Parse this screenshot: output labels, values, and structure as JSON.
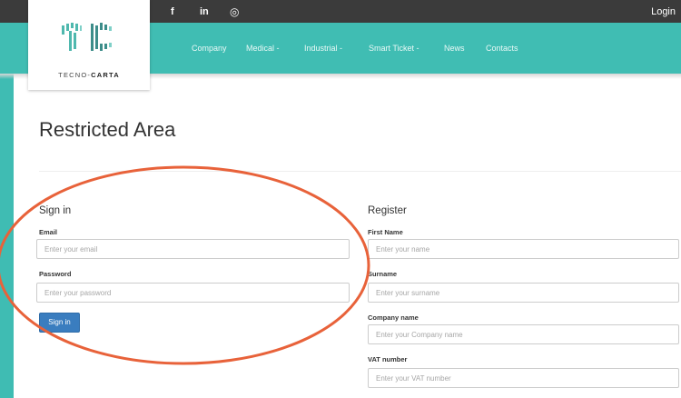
{
  "header": {
    "brand": "TECNO-CARTA",
    "brand_light": "TECNO-",
    "brand_bold": "CARTA",
    "social_icons": [
      "facebook-icon",
      "linkedin-icon",
      "instagram-icon"
    ],
    "social_glyphs": {
      "facebook": "f",
      "linkedin": "in",
      "instagram": "◎"
    },
    "login_label": "Login"
  },
  "nav": {
    "items": [
      {
        "label": "Company"
      },
      {
        "label": "Medical",
        "caret": "-"
      },
      {
        "label": "Industrial",
        "caret": "-"
      },
      {
        "label": "Smart Ticket",
        "caret": "-"
      },
      {
        "label": "News"
      },
      {
        "label": "Contacts"
      }
    ]
  },
  "page": {
    "title": "Restricted Area"
  },
  "signin": {
    "title": "Sign in",
    "email_label": "Email",
    "email_placeholder": "Enter your email",
    "email_value": "",
    "password_label": "Password",
    "password_placeholder": "Enter your password",
    "password_value": "",
    "button_label": "Sign in"
  },
  "register": {
    "title": "Register",
    "first_name_label": "First Name",
    "first_name_placeholder": "Enter your name",
    "surname_label": "Surname",
    "surname_placeholder": "Enter your surname",
    "company_label": "Company name",
    "company_placeholder": "Enter your Company name",
    "vat_label": "VAT number",
    "vat_placeholder": "Enter your VAT number"
  },
  "colors": {
    "teal": "#40bdb3",
    "topbar": "#3b3b3b",
    "button_blue": "#3a7dbf",
    "annotation_orange": "#e8623a"
  }
}
